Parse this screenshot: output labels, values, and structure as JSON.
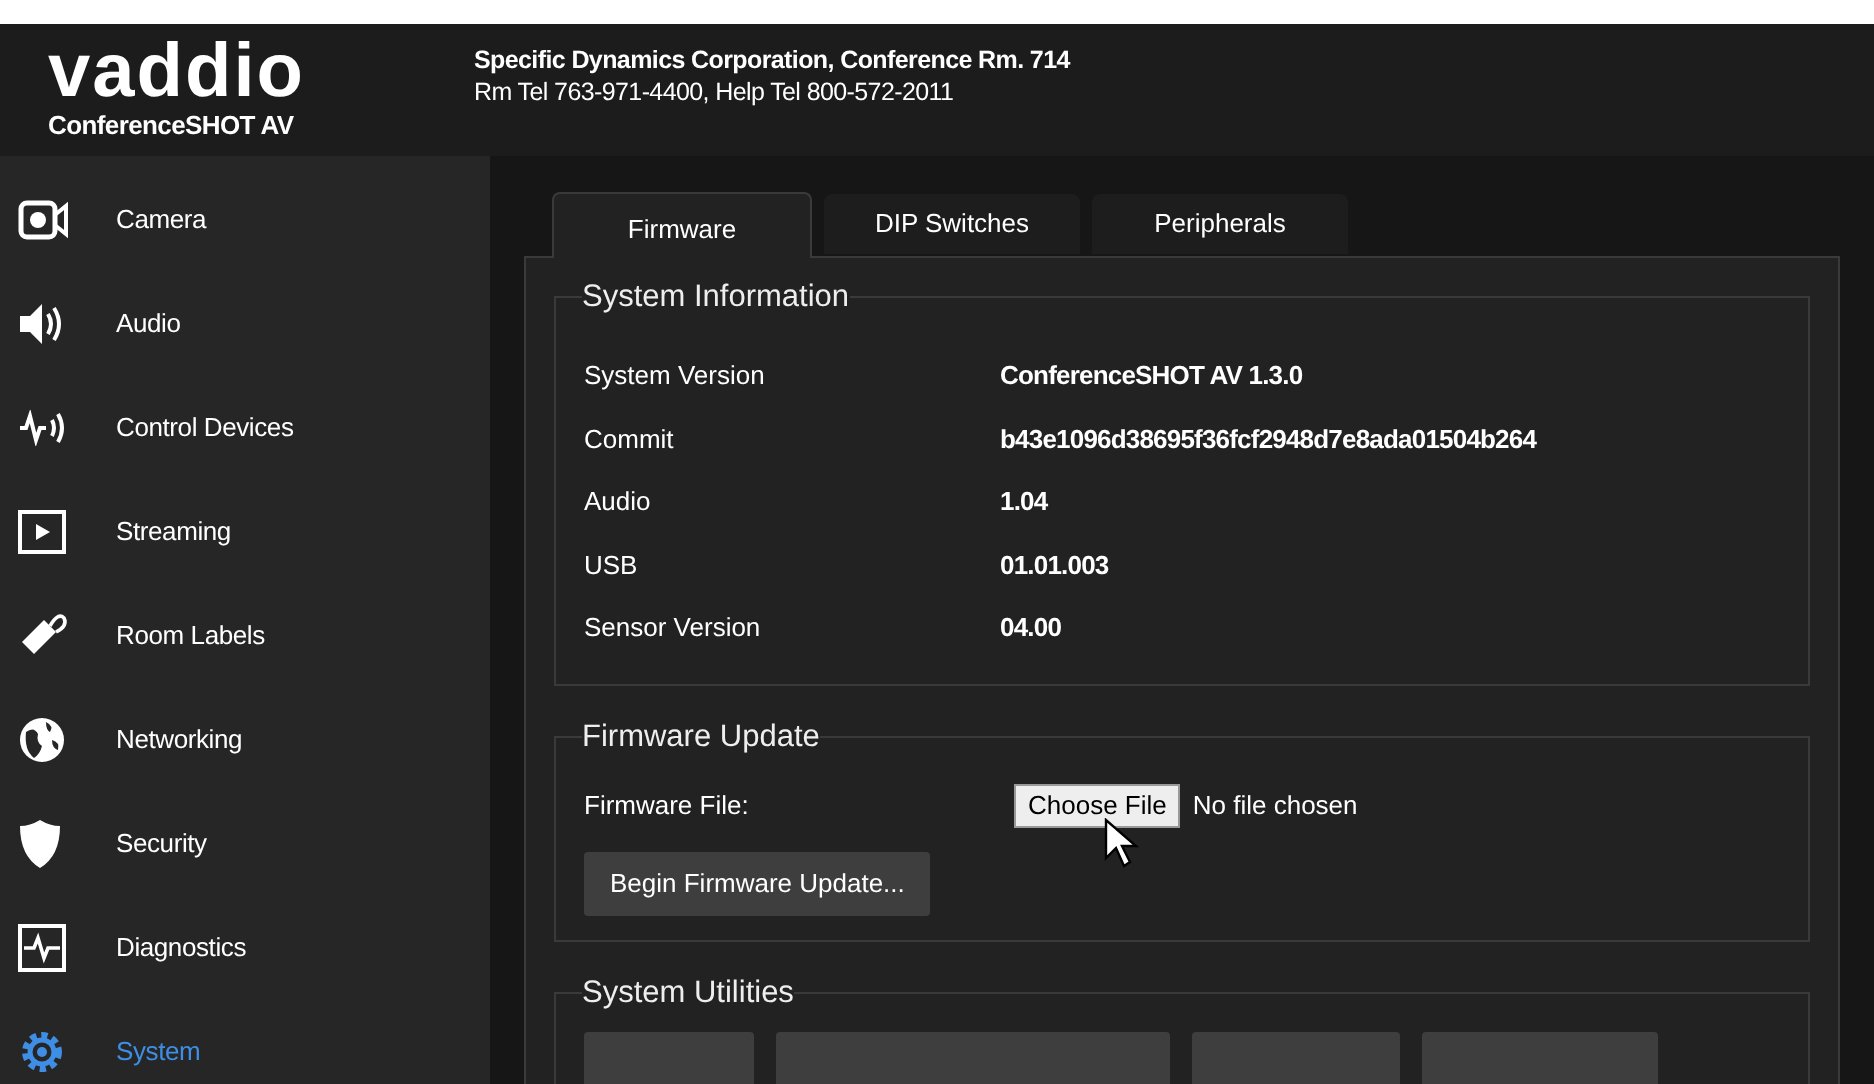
{
  "header": {
    "logo": "vaddio",
    "product": "ConferenceSHOT AV",
    "location": "Specific Dynamics Corporation, Conference Rm. 714",
    "phones": "Rm Tel 763-971-4400, Help Tel 800-572-2011"
  },
  "sidebar": {
    "items": [
      {
        "label": "Camera",
        "selected": false
      },
      {
        "label": "Audio",
        "selected": false
      },
      {
        "label": "Control Devices",
        "selected": false
      },
      {
        "label": "Streaming",
        "selected": false
      },
      {
        "label": "Room Labels",
        "selected": false
      },
      {
        "label": "Networking",
        "selected": false
      },
      {
        "label": "Security",
        "selected": false
      },
      {
        "label": "Diagnostics",
        "selected": false
      },
      {
        "label": "System",
        "selected": true
      }
    ]
  },
  "tabs": [
    {
      "label": "Firmware",
      "selected": true
    },
    {
      "label": "DIP Switches",
      "selected": false
    },
    {
      "label": "Peripherals",
      "selected": false
    }
  ],
  "system_information": {
    "title": "System Information",
    "rows": [
      {
        "label": "System Version",
        "value": "ConferenceSHOT AV 1.3.0"
      },
      {
        "label": "Commit",
        "value": "b43e1096d38695f36fcf2948d7e8ada01504b264"
      },
      {
        "label": "Audio",
        "value": "1.04"
      },
      {
        "label": "USB",
        "value": "01.01.003"
      },
      {
        "label": "Sensor Version",
        "value": "04.00"
      }
    ]
  },
  "firmware_update": {
    "title": "Firmware Update",
    "file_label": "Firmware File:",
    "choose_button": "Choose File",
    "file_status": "No file chosen",
    "begin_button": "Begin Firmware Update..."
  },
  "system_utilities": {
    "title": "System Utilities"
  }
}
